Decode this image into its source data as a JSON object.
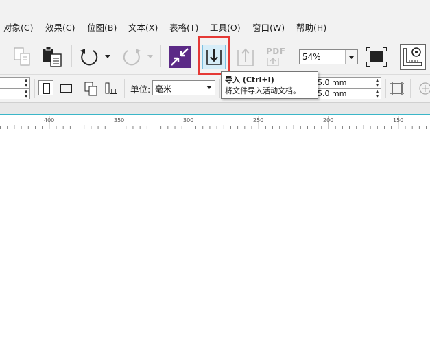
{
  "menu": [
    {
      "label": "对象",
      "key": "C"
    },
    {
      "label": "效果",
      "key": "C"
    },
    {
      "label": "位图",
      "key": "B"
    },
    {
      "label": "文本",
      "key": "X"
    },
    {
      "label": "表格",
      "key": "T"
    },
    {
      "label": "工具",
      "key": "O"
    },
    {
      "label": "窗口",
      "key": "W"
    },
    {
      "label": "帮助",
      "key": "H"
    }
  ],
  "toolbar": {
    "zoom_value": "54%",
    "pdf_label": "PDF",
    "import_tooltip_title": "导入 (Ctrl+I)",
    "import_tooltip_desc": "将文件导入活动文档。"
  },
  "property_bar": {
    "units_label": "单位:",
    "units_value": "毫米",
    "nudge_x": "5.0 mm",
    "nudge_y": "5.0 mm"
  },
  "ruler": {
    "labels": [
      "400",
      "350",
      "300",
      "250",
      "200",
      "150"
    ]
  },
  "colors": {
    "highlight": "#e53935",
    "accent_purple": "#5b2a86",
    "import_bg": "#d6edf8"
  }
}
